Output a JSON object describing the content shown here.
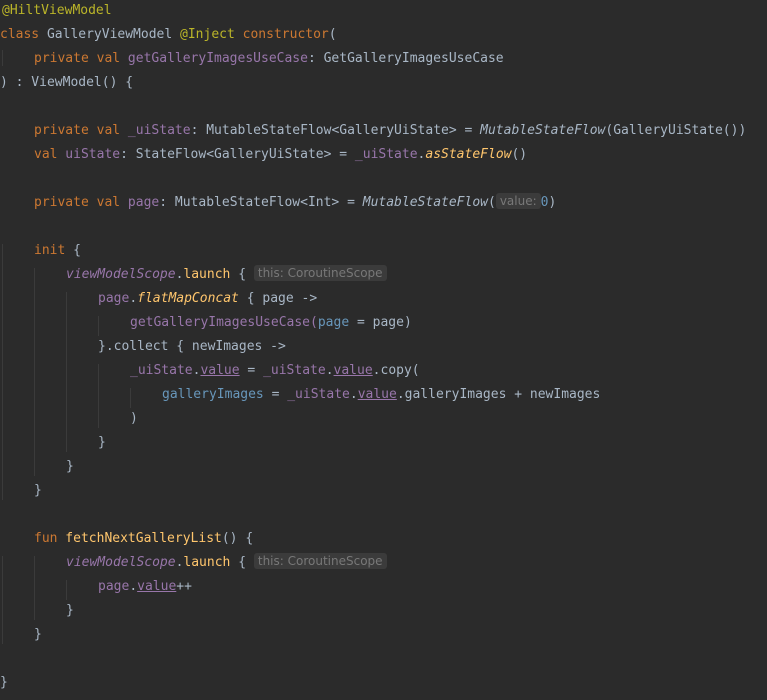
{
  "code": {
    "annotation_hilt": "@HiltViewModel",
    "kw_class": "class",
    "class_name": " GalleryViewModel ",
    "annotation_inject": "@Inject",
    "kw_constructor": " constructor",
    "paren_open": "(",
    "kw_private": "private",
    "kw_val": "val",
    "ctor_param": " getGalleryImagesUseCase",
    "ctor_param_type": ": GetGalleryImagesUseCase",
    "ctor_close": ") : ViewModel() {",
    "ui_state_private_name": " _uiState",
    "ui_state_private_type": ": MutableStateFlow<GalleryUiState> = ",
    "mutable_state_flow": "MutableStateFlow",
    "ui_state_private_init": "(GalleryUiState())",
    "ui_state_name": " uiState",
    "ui_state_type": ": StateFlow<GalleryUiState> = ",
    "ui_state_ref": "_uiState",
    "dot": ".",
    "as_state_flow": "asStateFlow",
    "call_empty": "()",
    "page_name": " page",
    "page_type": ": MutableStateFlow<Int> = ",
    "paren": "(",
    "hint_value": "value:",
    "zero": "0",
    "paren_close": ")",
    "kw_init": "init",
    "open_brace": " {",
    "view_model_scope": "viewModelScope",
    "launch": "launch",
    "hint_scope": "this: CoroutineScope",
    "page_ref": "page",
    "flat_map_concat": "flatMapConcat",
    "flat_lambda": " { page ->",
    "use_case_call": "getGalleryImagesUseCase(",
    "named_arg_page": "page",
    "named_arg_rest": " = page)",
    "collect_line": "}.collect { newImages ->",
    "value_prop": "value",
    "assign_mid": " = ",
    "copy_call": ".copy(",
    "gallery_images_arg": "galleryImages",
    "gallery_images_rest": ".galleryImages + newImages",
    "close_paren": ")",
    "close_brace": "}",
    "kw_fun": "fun",
    "fetch_fn": " fetchNextGalleryList",
    "fetch_sig_rest": "() {",
    "increment": "++"
  }
}
